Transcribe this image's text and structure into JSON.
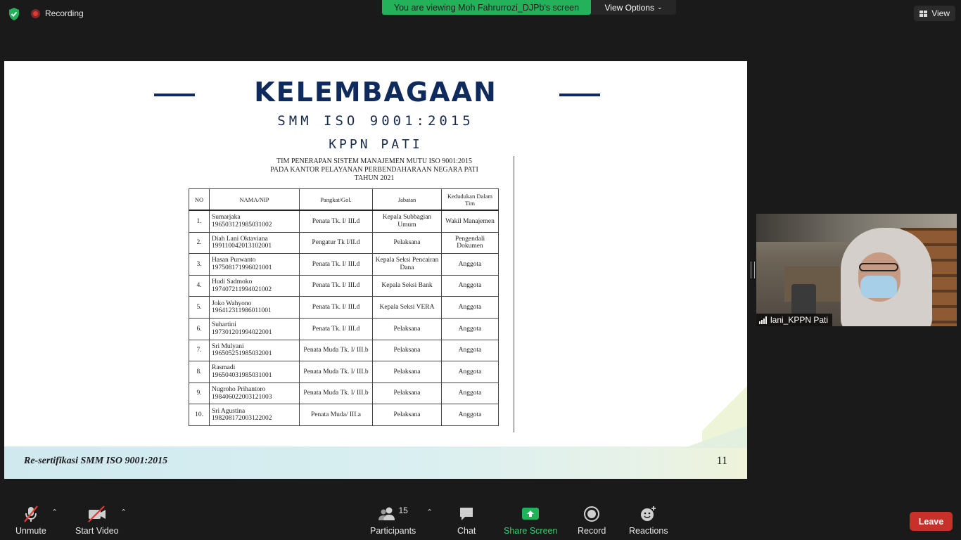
{
  "top": {
    "recording_label": "Recording",
    "viewing_banner": "You are viewing Moh Fahrurrozi_DJPb's screen",
    "view_options": "View Options",
    "view_button": "View"
  },
  "slide": {
    "title": "KELEMBAGAAN",
    "subtitle1": "SMM ISO 9001:2015",
    "subtitle2": "KPPN PATI",
    "doc_heading": [
      "TIM PENERAPAN SISTEM MANAJEMEN MUTU ISO 9001:2015",
      "PADA KANTOR PELAYANAN PERBENDAHARAAN NEGARA PATI",
      "TAHUN 2021"
    ],
    "table": {
      "headers": [
        "NO",
        "NAMA/NIP",
        "Pangkat/Gol.",
        "Jabatan",
        "Kedudukan Dalam Tim"
      ],
      "rows": [
        {
          "no": "1.",
          "nama": "Sumarjaka",
          "nip": "196503121985031002",
          "pangkat": "Penata Tk. I/ III.d",
          "jabatan": "Kepala Subbagian Umum",
          "kedudukan": "Wakil Manajemen"
        },
        {
          "no": "2.",
          "nama": "Diah Lani Oktaviana",
          "nip": "199110042013102001",
          "pangkat": "Pengatur Tk I/II.d",
          "jabatan": "Pelaksana",
          "kedudukan": "Pengendali Dokumen"
        },
        {
          "no": "3.",
          "nama": "Hasan Purwanto",
          "nip": "197508171996021001",
          "pangkat": "Penata Tk. I/ III.d",
          "jabatan": "Kepala Seksi Pencairan Dana",
          "kedudukan": "Anggota"
        },
        {
          "no": "4.",
          "nama": "Hudi Sadmoko",
          "nip": "197407211994021002",
          "pangkat": "Penata Tk. I/ III.d",
          "jabatan": "Kepala Seksi Bank",
          "kedudukan": "Anggota"
        },
        {
          "no": "5.",
          "nama": "Joko Wahyono",
          "nip": "196412311986011001",
          "pangkat": "Penata Tk. I/ III.d",
          "jabatan": "Kepala Seksi VERA",
          "kedudukan": "Anggota"
        },
        {
          "no": "6.",
          "nama": "Suhartini",
          "nip": "197301201994022001",
          "pangkat": "Penata Tk. I/ III.d",
          "jabatan": "Pelaksana",
          "kedudukan": "Anggota"
        },
        {
          "no": "7.",
          "nama": "Sri Mulyani",
          "nip": "196505251985032001",
          "pangkat": "Penata Muda Tk. I/ III.b",
          "jabatan": "Pelaksana",
          "kedudukan": "Anggota"
        },
        {
          "no": "8.",
          "nama": "Rasmadi",
          "nip": "196504031985031001",
          "pangkat": "Penata Muda Tk. I/ III.b",
          "jabatan": "Pelaksana",
          "kedudukan": "Anggota"
        },
        {
          "no": "9.",
          "nama": "Nugroho Prihantoro",
          "nip": "198406022003121003",
          "pangkat": "Penata Muda Tk. I/ III.b",
          "jabatan": "Pelaksana",
          "kedudukan": "Anggota"
        },
        {
          "no": "10.",
          "nama": "Sri Agustina",
          "nip": "198208172003122002",
          "pangkat": "Penata Muda/ III.a",
          "jabatan": "Pelaksana",
          "kedudukan": "Anggota"
        }
      ]
    },
    "footer": "Re-sertifikasi SMM ISO 9001:2015",
    "page_number": "11"
  },
  "participant": {
    "name": "lani_KPPN Pati"
  },
  "toolbar": {
    "unmute": "Unmute",
    "start_video": "Start Video",
    "participants": "Participants",
    "participants_count": "15",
    "chat": "Chat",
    "share_screen": "Share Screen",
    "record": "Record",
    "reactions": "Reactions",
    "leave": "Leave"
  },
  "colors": {
    "banner_green": "#23b15a",
    "leave_red": "#c8302a",
    "title_navy": "#0f2a5c"
  }
}
